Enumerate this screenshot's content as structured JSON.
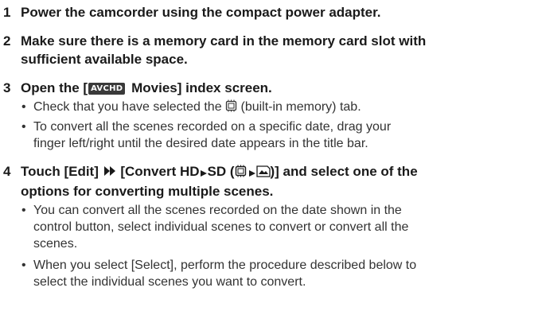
{
  "steps": [
    {
      "number": "1",
      "title": "Power the camcorder using the compact power adapter."
    },
    {
      "number": "2",
      "title_line1": "Make sure there is a memory card in the memory card slot with",
      "title_line2": "sufficient available space."
    },
    {
      "number": "3",
      "title_pre": "Open the [",
      "badge": "AVCHD",
      "title_post": " Movies] index screen.",
      "bullets": [
        {
          "pre": "Check that you have selected the ",
          "post": " (built-in memory) tab."
        },
        {
          "line1": "To convert all the scenes recorded on a specific date, drag your",
          "line2": "finger left/right until the desired date appears in the title bar."
        }
      ]
    },
    {
      "number": "4",
      "title_pre": "Touch [Edit] ",
      "title_mid": " [Convert HD",
      "title_sd": "SD (",
      "title_post": ")] and select one of the",
      "title_line2": "options for converting multiple scenes.",
      "bullets": [
        {
          "line1": "You can convert all the scenes recorded on the date shown in the",
          "line2": "control button, select individual scenes to convert or convert all the",
          "line3": "scenes."
        },
        {
          "line1": "When you select [Select], perform the procedure described below to",
          "line2": "select the individual scenes you want to convert."
        }
      ]
    }
  ],
  "bullet_char": "•",
  "icons": {
    "memory": "built-in-memory-icon",
    "next": "next-step-arrow-icon",
    "sd": "sd-card-icon"
  }
}
